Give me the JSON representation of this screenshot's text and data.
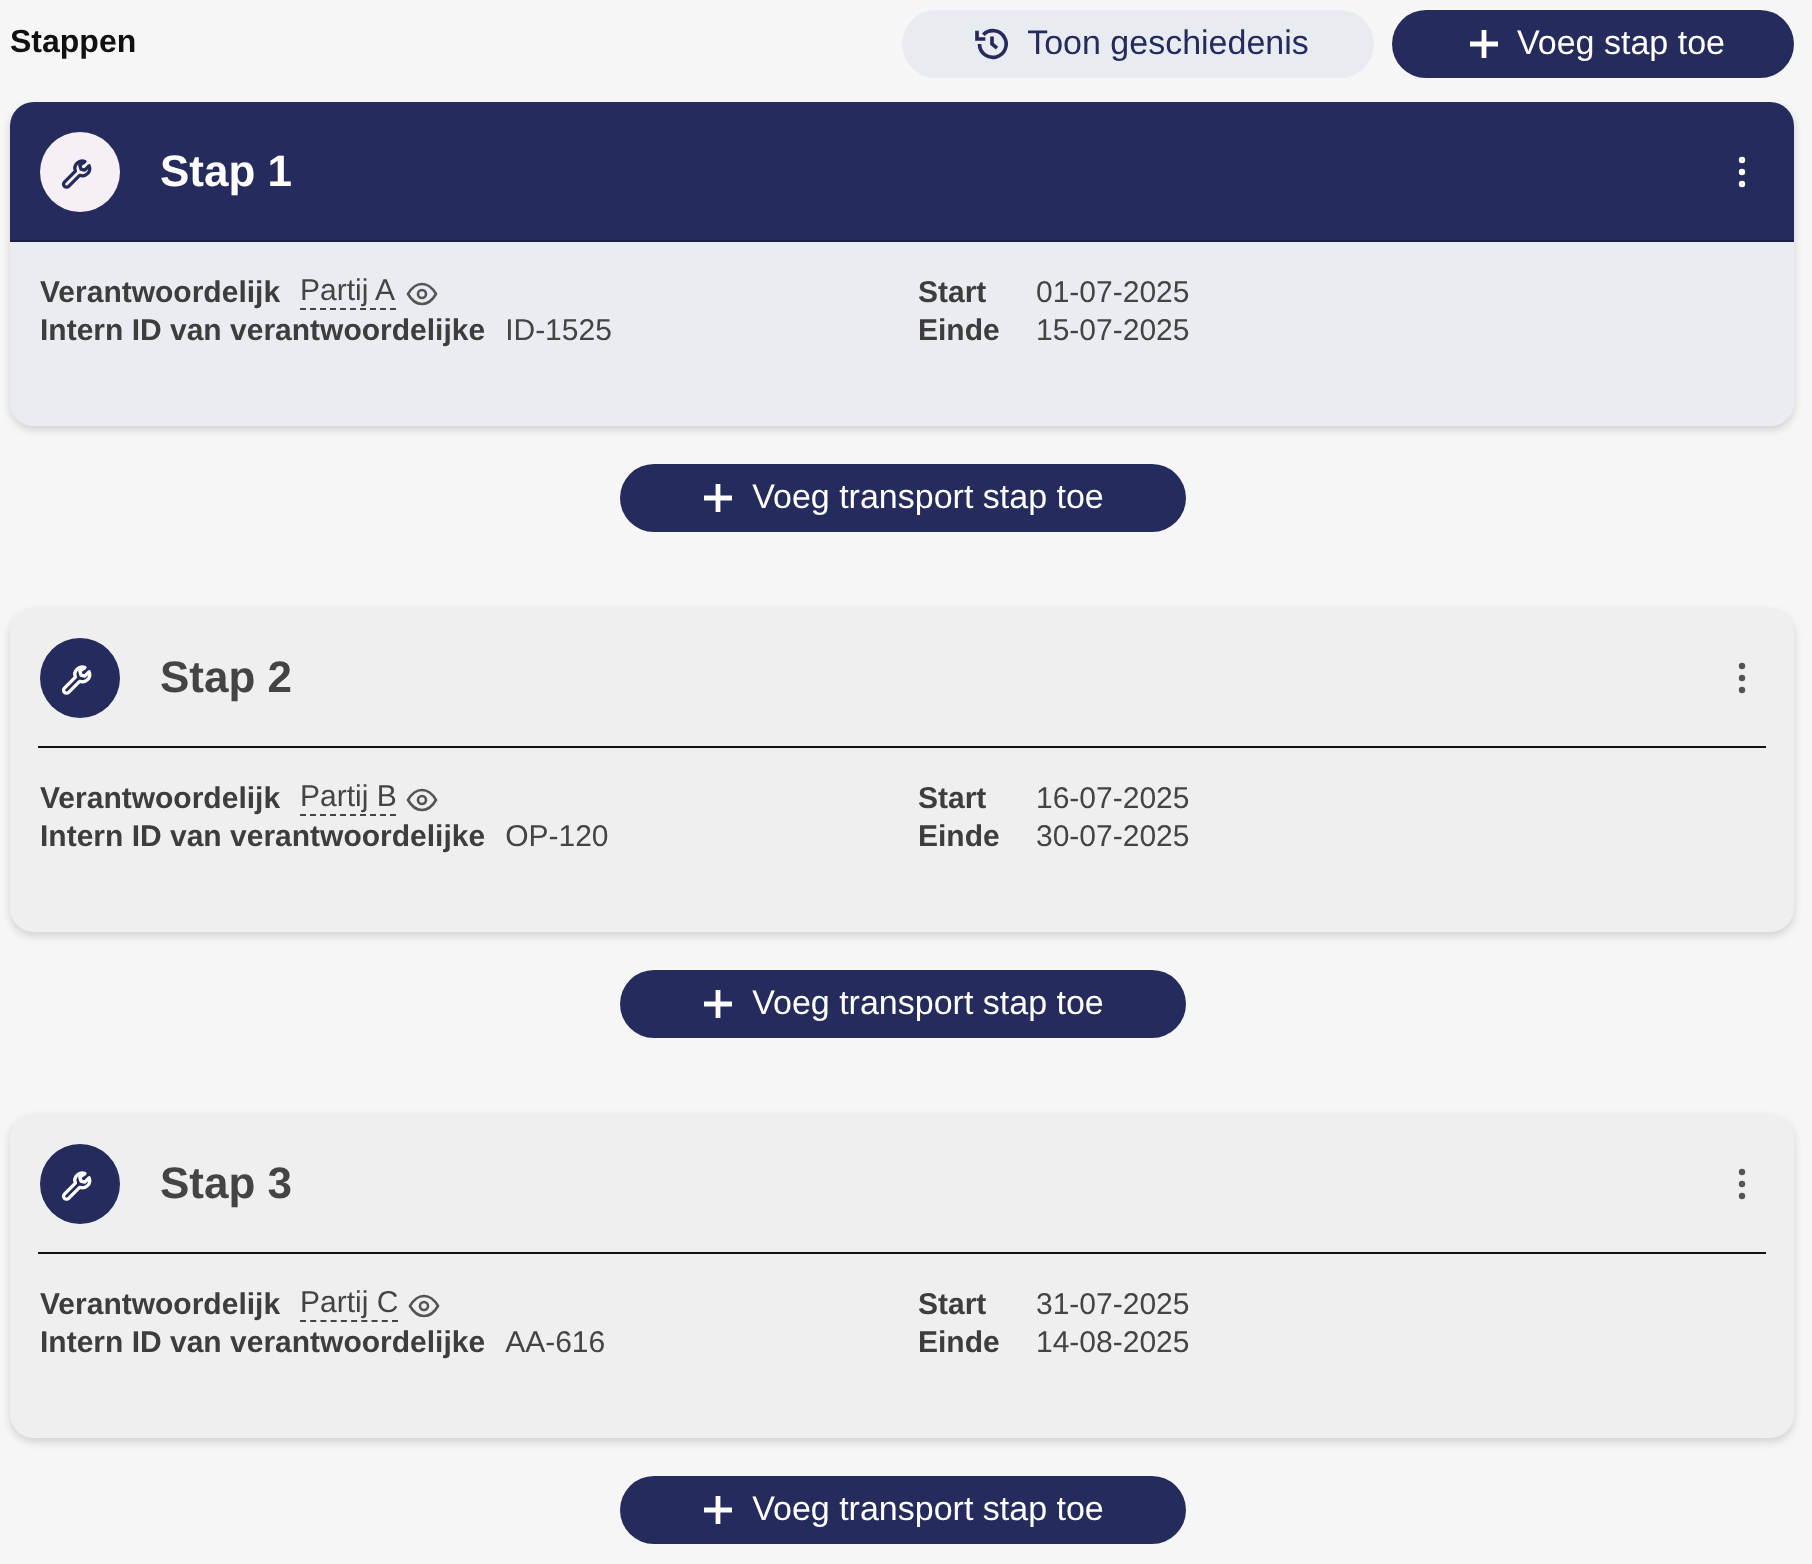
{
  "title": "Stappen",
  "actions": [
    {
      "kind": "history",
      "label": "Toon geschiedenis"
    },
    {
      "kind": "add",
      "label": "Voeg stap toe"
    }
  ],
  "steps": [
    {
      "title": "Stap 1",
      "selected": true,
      "responsible_label": "Verantwoordelijk",
      "responsible": "Partij A",
      "internal_id_label": "Intern ID van verantwoordelijke",
      "internal_id": "ID-1525",
      "start_label": "Start",
      "start": "01-07-2025",
      "end_label": "Einde",
      "end": "15-07-2025",
      "add_transport": "Voeg transport stap toe"
    },
    {
      "title": "Stap 2",
      "selected": false,
      "responsible_label": "Verantwoordelijk",
      "responsible": "Partij B",
      "internal_id_label": "Intern ID van verantwoordelijke",
      "internal_id": "OP-120",
      "start_label": "Start",
      "start": "16-07-2025",
      "end_label": "Einde",
      "end": "30-07-2025",
      "add_transport": "Voeg transport stap toe"
    },
    {
      "title": "Stap 3",
      "selected": false,
      "responsible_label": "Verantwoordelijk",
      "responsible": "Partij C",
      "internal_id_label": "Intern ID van verantwoordelijke",
      "internal_id": "AA-616",
      "start_label": "Start",
      "start": "31-07-2025",
      "end_label": "Einde",
      "end": "14-08-2025",
      "add_transport": "Voeg transport stap toe"
    }
  ]
}
